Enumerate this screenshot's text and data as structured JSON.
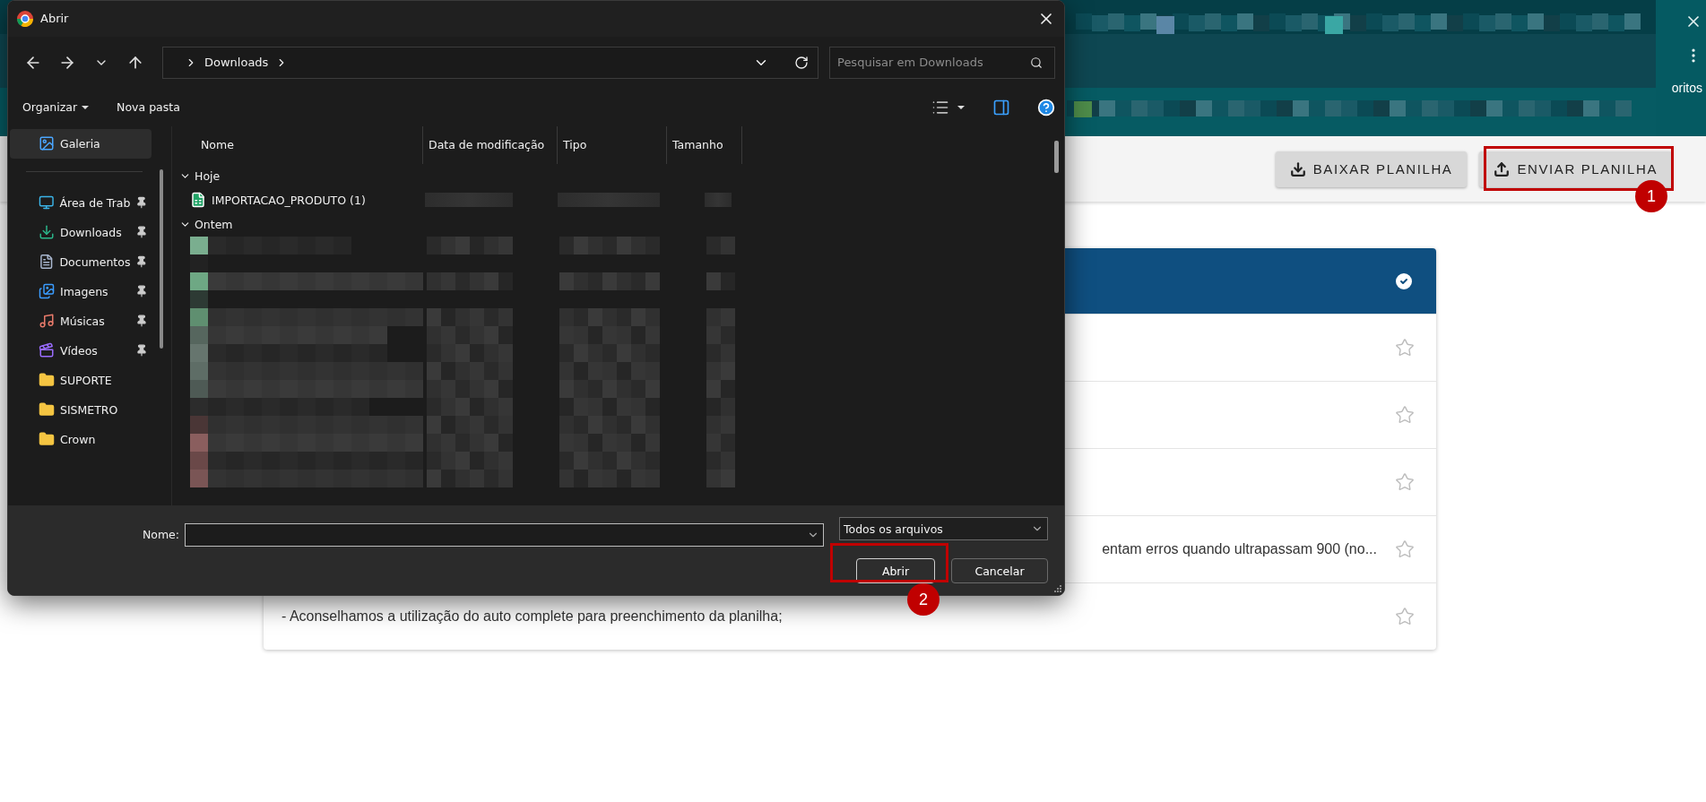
{
  "background_page": {
    "browser_bar": {
      "bookmarks_text": "oritos"
    },
    "toolbar": {
      "buttons": [
        {
          "label": "BAIXAR PLANILHA"
        },
        {
          "label": "ENVIAR PLANILHA"
        }
      ]
    },
    "card": {
      "rows": [
        {
          "kind": "empty"
        },
        {
          "kind": "empty"
        },
        {
          "kind": "empty"
        },
        {
          "kind": "tail",
          "text": "entam erros quando ultrapassam 900 (no..."
        },
        {
          "kind": "full",
          "text": "- Aconselhamos a utilização do auto complete para preenchimento da planilha;"
        }
      ]
    }
  },
  "dialog": {
    "title": "Abrir",
    "breadcrumb": "Downloads",
    "search": {
      "placeholder": "Pesquisar em Downloads"
    },
    "commands": [
      "Organizar",
      "Nova pasta"
    ],
    "sidebar": {
      "items": [
        {
          "label": "Galeria",
          "pinned": false,
          "selected": true
        },
        {
          "label": "Área de Trab",
          "pinned": true,
          "selected": false
        },
        {
          "label": "Downloads",
          "pinned": true,
          "selected": false
        },
        {
          "label": "Documentos",
          "pinned": true,
          "selected": false
        },
        {
          "label": "Imagens",
          "pinned": true,
          "selected": false
        },
        {
          "label": "Músicas",
          "pinned": true,
          "selected": false
        },
        {
          "label": "Vídeos",
          "pinned": true,
          "selected": false
        },
        {
          "label": "SUPORTE",
          "pinned": false,
          "selected": false
        },
        {
          "label": "SISMETRO",
          "pinned": false,
          "selected": false
        },
        {
          "label": "Crown",
          "pinned": false,
          "selected": false
        }
      ]
    },
    "columns": [
      "Nome",
      "Data de modificação",
      "Tipo",
      "Tamanho"
    ],
    "groups": [
      {
        "label": "Hoje",
        "kind": "list",
        "expanded": true,
        "files": [
          {
            "name": "IMPORTACAO_PRODUTO (1)"
          }
        ]
      },
      {
        "label": "Ontem",
        "kind": "pixelated",
        "expanded": true
      }
    ],
    "name_field": {
      "label": "Nome:"
    },
    "filter": "Todos os arquivos",
    "buttons": [
      "Abrir",
      "Cancelar"
    ]
  },
  "annotations": [
    {
      "label": "1"
    },
    {
      "label": "2"
    }
  ]
}
